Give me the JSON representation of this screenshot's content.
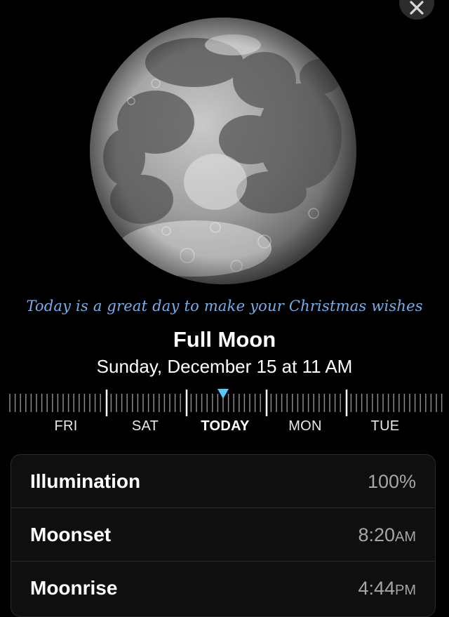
{
  "message": "Today is a great day to make your Christmas wishes",
  "phase": {
    "name": "Full Moon",
    "date": "Sunday, December 15 at 11 AM"
  },
  "timeline": {
    "days": [
      "FRI",
      "SAT",
      "TODAY",
      "MON",
      "TUE"
    ],
    "selected": "TODAY"
  },
  "details": [
    {
      "label": "Illumination",
      "value": "100%",
      "suffix": ""
    },
    {
      "label": "Moonset",
      "value": "8:20",
      "suffix": "AM"
    },
    {
      "label": "Moonrise",
      "value": "4:44",
      "suffix": "PM"
    }
  ],
  "colors": {
    "accent": "#5ac8fa",
    "wish_text": "#78aee8",
    "secondary_text": "#a6a6a8"
  },
  "icons": {
    "close": "close-icon",
    "marker": "triangle-down-icon"
  }
}
